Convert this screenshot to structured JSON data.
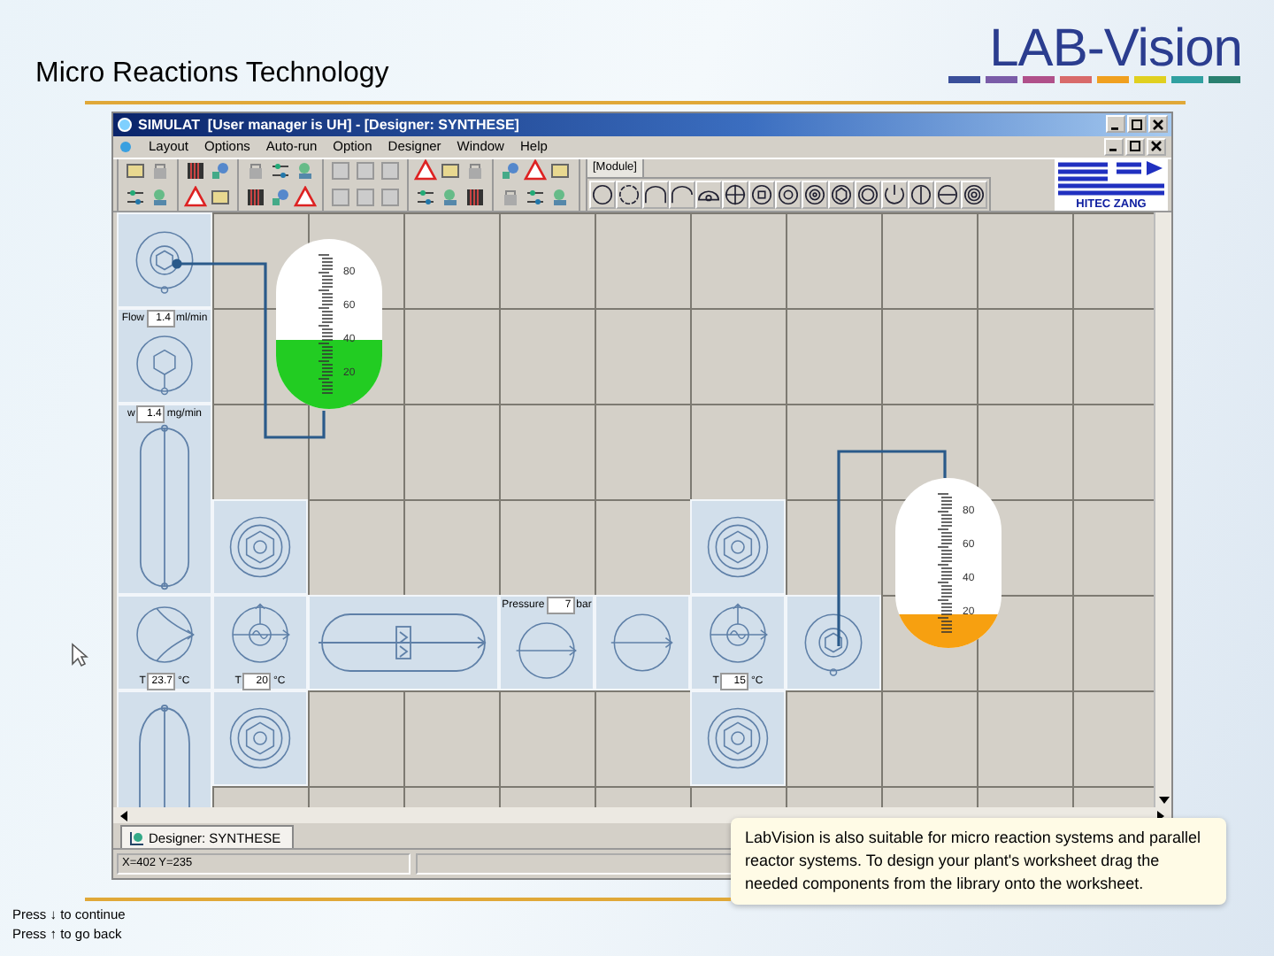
{
  "slide": {
    "title": "Micro Reactions Technology",
    "logo": "LAB-Vision"
  },
  "window": {
    "title": "SIMULAT  [User manager is UH] - [Designer: SYNTHESE]"
  },
  "menu": [
    "Layout",
    "Options",
    "Auto-run",
    "Option",
    "Designer",
    "Window",
    "Help"
  ],
  "toolbar": {
    "module_tab": "[Module]",
    "brand": "HITEC ZANG"
  },
  "worksheet": {
    "modules": [
      {
        "kind": "valve"
      },
      {
        "kind": "pump",
        "param": {
          "label": "Flow",
          "value": "1.4",
          "unit": "ml/min"
        }
      },
      {
        "kind": "column",
        "param": {
          "label": "w",
          "value": "1.4",
          "unit": "mg/min"
        }
      },
      {
        "kind": "nut"
      },
      {
        "kind": "nut"
      },
      {
        "kind": "mixer",
        "param": {
          "label": "T",
          "value": "23.7",
          "unit": "°C"
        }
      },
      {
        "kind": "heat-exchanger",
        "param": {
          "label": "T",
          "value": "20",
          "unit": "°C"
        }
      },
      {
        "kind": "reactor"
      },
      {
        "kind": "separator",
        "param": {
          "label": "Pressure",
          "value": "7",
          "unit": "bar"
        }
      },
      {
        "kind": "separator"
      },
      {
        "kind": "heat-exchanger",
        "param": {
          "label": "T",
          "value": "15",
          "unit": "°C"
        }
      },
      {
        "kind": "valve"
      },
      {
        "kind": "tube"
      },
      {
        "kind": "nut"
      },
      {
        "kind": "nut"
      }
    ],
    "tanks": [
      {
        "level": 0.41,
        "color": "#22cc22",
        "scale": [
          "80",
          "60",
          "40",
          "20"
        ]
      },
      {
        "level": 0.2,
        "color": "#f7a010",
        "scale": [
          "80",
          "60",
          "40",
          "20"
        ]
      }
    ]
  },
  "tabs": [
    {
      "label": "Designer: SYNTHESE",
      "selected": true
    }
  ],
  "status_bar": "X=402  Y=235",
  "callout": "LabVision is also suitable for micro reaction systems and parallel reactor systems. To design your plant's worksheet drag the needed components from the library onto the worksheet.",
  "footer": [
    "Press ↓ to continue",
    "Press ↑ to go back"
  ]
}
